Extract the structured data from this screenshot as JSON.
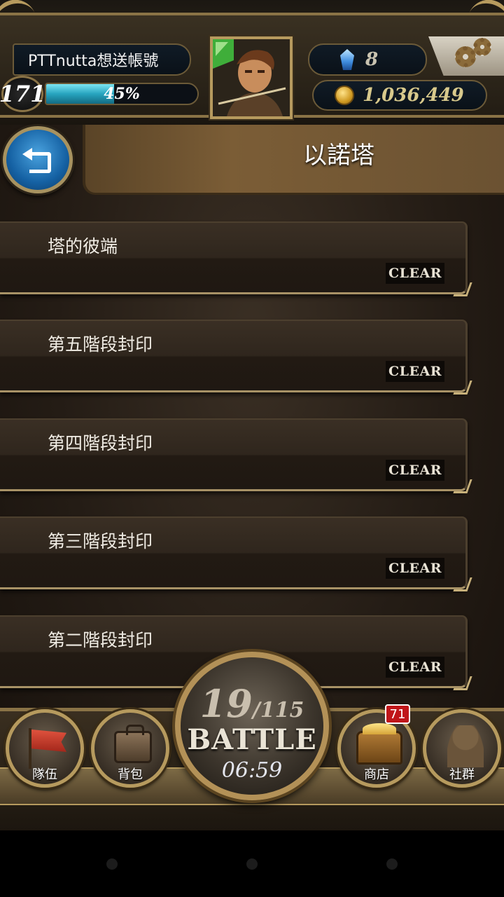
{
  "player": {
    "name": "PTTnutta想送帳號",
    "level": "171",
    "exp_percent_label": "45%",
    "exp_fraction": 0.45
  },
  "currency": {
    "gems": "8",
    "coins": "1,036,449"
  },
  "page": {
    "title": "以諾塔"
  },
  "stages": [
    {
      "name": "塔的彼端",
      "status": "CLEAR"
    },
    {
      "name": "第五階段封印",
      "status": "CLEAR"
    },
    {
      "name": "第四階段封印",
      "status": "CLEAR"
    },
    {
      "name": "第三階段封印",
      "status": "CLEAR"
    },
    {
      "name": "第二階段封印",
      "status": "CLEAR"
    }
  ],
  "battle": {
    "current": "19",
    "max": "/115",
    "label": "BATTLE",
    "timer": "06:59"
  },
  "nav": {
    "team": "隊伍",
    "bag": "背包",
    "shop": "商店",
    "shop_badge": "71",
    "social": "社群"
  },
  "colors": {
    "exp_bar": "#27a4bf",
    "back_button": "#1561a3",
    "shop_badge": "#c0161a",
    "frame_gold": "#b69a5e"
  }
}
